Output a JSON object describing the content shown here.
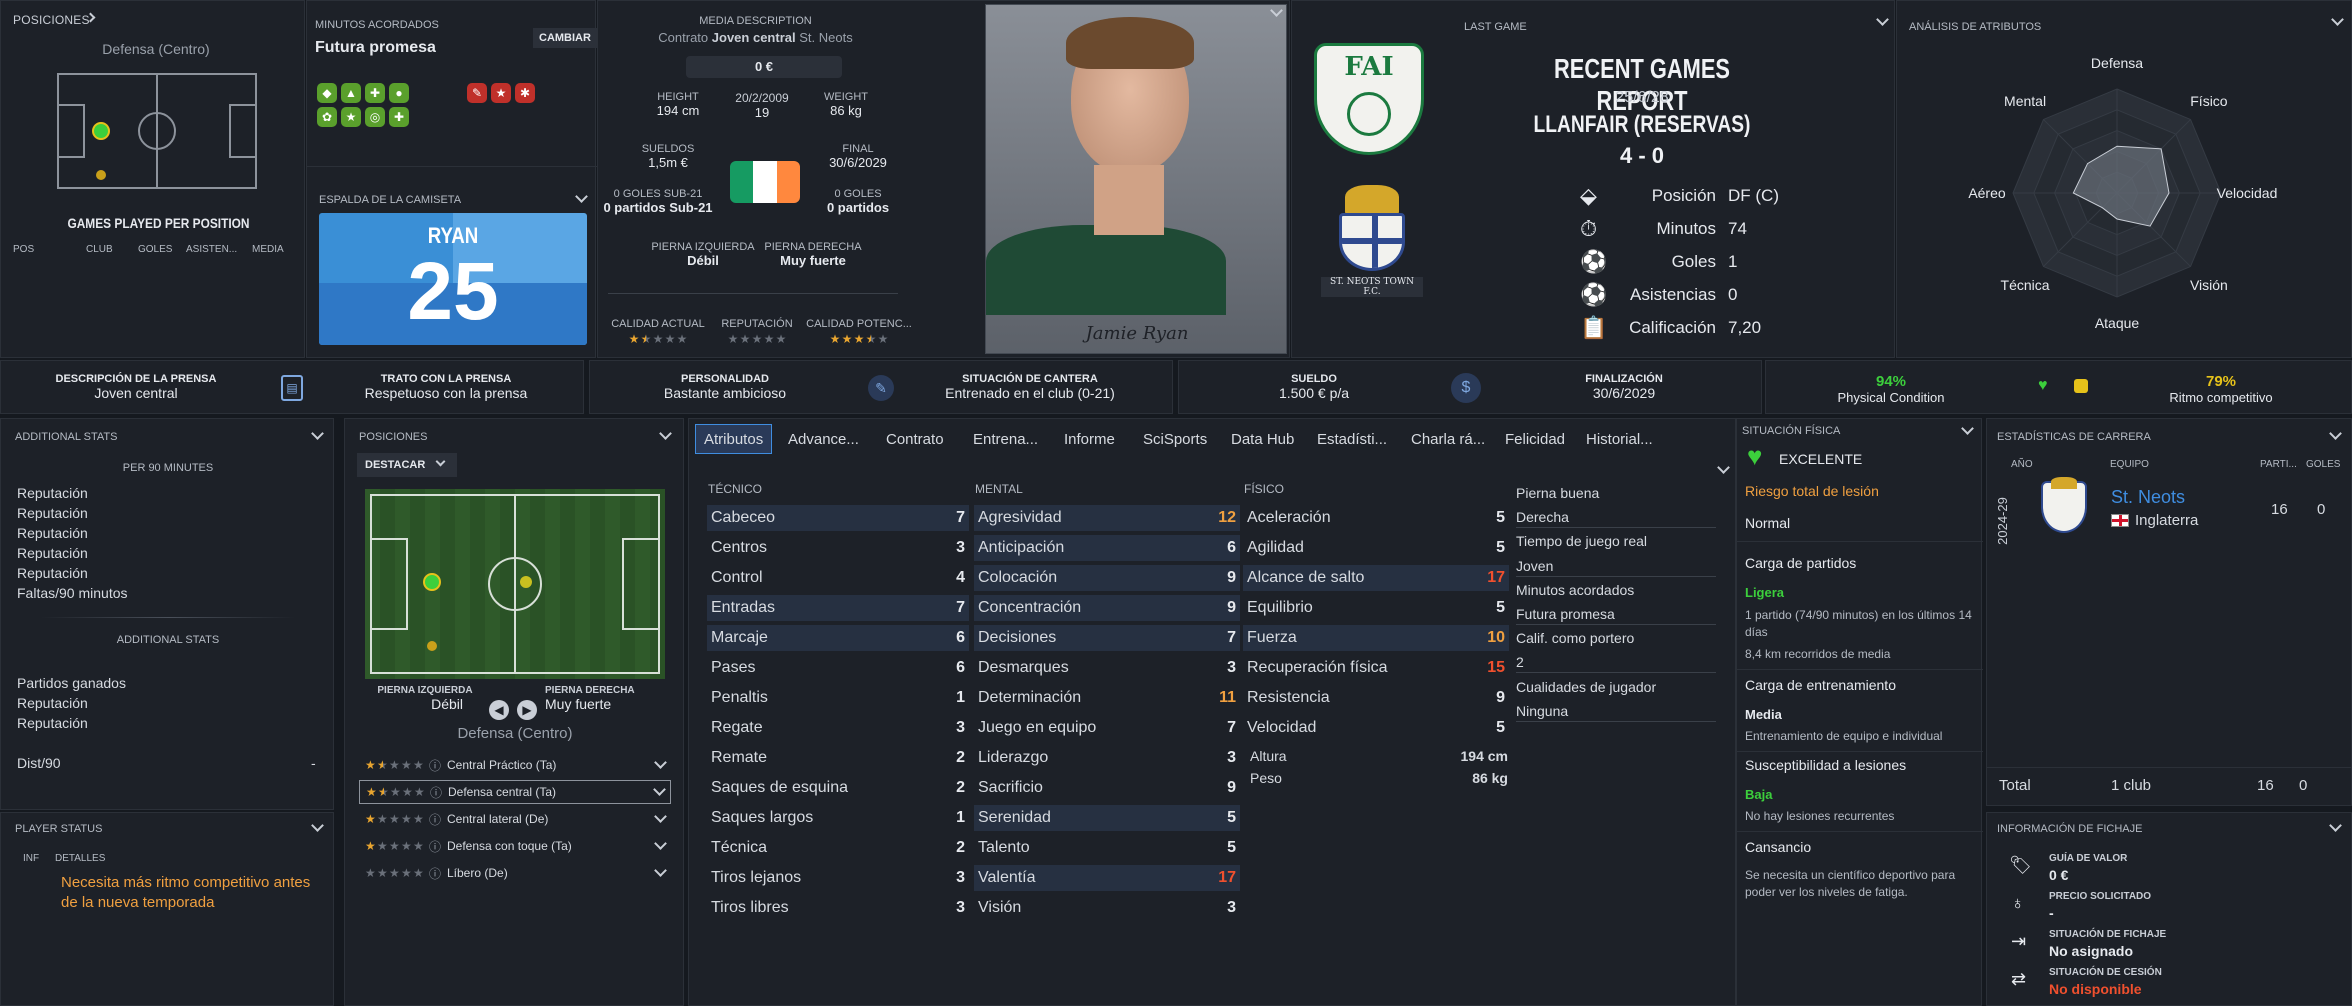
{
  "colors": {
    "accent_blue": "#3f8de0",
    "orange": "#f0a040",
    "red_value": "#f0502e",
    "green": "#3ccf3c",
    "yellow": "#e6c21a",
    "bg": "#15191f",
    "panel": "#1d2128"
  },
  "left_top": {
    "positions_label": "POSICIONES",
    "position": "Defensa (Centro)",
    "games_title": "GAMES PLAYED PER POSITION",
    "cols": [
      "POS",
      "CLUB",
      "GOLES",
      "ASISTEN...",
      "MEDIA"
    ]
  },
  "minutes": {
    "label": "MINUTOS ACORDADOS",
    "value": "Futura promesa",
    "change_button": "CAMBIAR"
  },
  "shirt": {
    "label": "ESPALDA DE LA CAMISETA",
    "name": "RYAN",
    "number": "25"
  },
  "media": {
    "desc_label": "MEDIA DESCRIPTION",
    "desc_value": "Joven central",
    "contract_label": "Contrato",
    "contract_club": "St. Neots",
    "value": "0 €"
  },
  "bio": {
    "height_label": "HEIGHT",
    "height": "194 cm",
    "dob": "20/2/2009",
    "age": "19",
    "weight_label": "WEIGHT",
    "weight": "86 kg",
    "wage_label": "SUELDOS",
    "wage": "1,5m €",
    "end_label": "FINAL",
    "end": "30/6/2029",
    "u21_goals": "0 GOLES SUB-21",
    "u21_games": "0 partidos Sub-21",
    "goals": "0 GOLES",
    "games": "0 partidos",
    "left_foot_label": "PIERNA IZQUIERDA",
    "left_foot": "Débil",
    "right_foot_label": "PIERNA DERECHA",
    "right_foot": "Muy fuerte",
    "ca_label": "CALIDAD ACTUAL",
    "rep_label": "REPUTACIÓN",
    "pa_label": "CALIDAD POTENC...",
    "ca_stars": 1.5,
    "rep_stars": 0,
    "pa_stars": 3.5
  },
  "photo": {
    "signature": "Jamie Ryan"
  },
  "last_game": {
    "label": "LAST GAME",
    "title": "RECENT GAMES REPORT",
    "date": "25/6/28",
    "opponent": "LLANFAIR (RESERVAS)",
    "score": "4 - 0",
    "position_label": "Posición",
    "position": "DF (C)",
    "minutes_label": "Minutos",
    "minutes": "74",
    "goals_label": "Goles",
    "goals": "1",
    "assists_label": "Asistencias",
    "assists": "0",
    "rating_label": "Calificación",
    "rating": "7,20",
    "fai_logo": "FAI",
    "club_crest_text": "ST. NEOTS TOWN F.C."
  },
  "radar": {
    "label": "ANÁLISIS DE ATRIBUTOS",
    "axes": [
      "Defensa",
      "Físico",
      "Velocidad",
      "Visión",
      "Ataque",
      "Técnica",
      "Aéreo",
      "Mental"
    ],
    "values": [
      0.45,
      0.6,
      0.5,
      0.45,
      0.25,
      0.2,
      0.42,
      0.4
    ]
  },
  "strip": {
    "press_desc_label": "DESCRIPCIÓN DE LA PRENSA",
    "press_desc": "Joven central",
    "press_treat_label": "TRATO CON LA PRENSA",
    "press_treat": "Respetuoso con la prensa",
    "personality_label": "PERSONALIDAD",
    "personality": "Bastante ambicioso",
    "youth_label": "SITUACIÓN DE CANTERA",
    "youth": "Entrenado en el club (0-21)",
    "wage_label": "SUELDO",
    "wage": "1.500 € p/a",
    "expiry_label": "FINALIZACIÓN",
    "expiry": "30/6/2029",
    "physical_pct": "94%",
    "physical_label": "Physical Condition",
    "match_pct": "79%",
    "match_label": "Ritmo competitivo"
  },
  "add_stats": {
    "title": "ADDITIONAL STATS",
    "per90": "PER 90 MINUTES",
    "list1": [
      "Reputación",
      "Reputación",
      "Reputación",
      "Reputación",
      "Reputación",
      "Faltas/90 minutos"
    ],
    "sub": "ADDITIONAL STATS",
    "list2": [
      "Partidos ganados",
      "Reputación",
      "Reputación"
    ],
    "dist_label": "Dist/90",
    "dist_val": "-"
  },
  "player_status": {
    "title": "PLAYER STATUS",
    "col1": "INF",
    "col2": "DETALLES",
    "message": "Necesita más ritmo competitivo antes de la nueva temporada"
  },
  "positions": {
    "title": "POSICIONES",
    "dropdown": "DESTACAR",
    "left_label": "PIERNA IZQUIERDA",
    "left": "Débil",
    "right_label": "PIERNA DERECHA",
    "right": "Muy fuerte",
    "position": "Defensa (Centro)",
    "roles": [
      {
        "name": "Central Práctico (Ta)",
        "stars": 1.5
      },
      {
        "name": "Defensa central (Ta)",
        "stars": 1.5
      },
      {
        "name": "Central lateral (De)",
        "stars": 1
      },
      {
        "name": "Defensa con toque (Ta)",
        "stars": 1
      },
      {
        "name": "Líbero (De)",
        "stars": 0
      }
    ]
  },
  "tabs": [
    "Atributos",
    "Advance...",
    "Contrato",
    "Entrena...",
    "Informe",
    "SciSports",
    "Data Hub",
    "Estadísti...",
    "Charla rá...",
    "Felicidad",
    "Historial..."
  ],
  "attributes": {
    "tecnico_label": "TÉCNICO",
    "mental_label": "MENTAL",
    "fisico_label": "FÍSICO",
    "tecnico": [
      {
        "n": "Cabeceo",
        "v": "7",
        "hl": true
      },
      {
        "n": "Centros",
        "v": "3"
      },
      {
        "n": "Control",
        "v": "4"
      },
      {
        "n": "Entradas",
        "v": "7",
        "hl": true
      },
      {
        "n": "Marcaje",
        "v": "6",
        "hl": true
      },
      {
        "n": "Pases",
        "v": "6"
      },
      {
        "n": "Penaltis",
        "v": "1"
      },
      {
        "n": "Regate",
        "v": "3"
      },
      {
        "n": "Remate",
        "v": "2"
      },
      {
        "n": "Saques de esquina",
        "v": "2"
      },
      {
        "n": "Saques largos",
        "v": "1"
      },
      {
        "n": "Técnica",
        "v": "2"
      },
      {
        "n": "Tiros lejanos",
        "v": "3"
      },
      {
        "n": "Tiros libres",
        "v": "3"
      }
    ],
    "mental": [
      {
        "n": "Agresividad",
        "v": "12",
        "hl": true
      },
      {
        "n": "Anticipación",
        "v": "6",
        "hl": true
      },
      {
        "n": "Colocación",
        "v": "9",
        "hl": true
      },
      {
        "n": "Concentración",
        "v": "9",
        "hl": true
      },
      {
        "n": "Decisiones",
        "v": "7",
        "hl": true
      },
      {
        "n": "Desmarques",
        "v": "3"
      },
      {
        "n": "Determinación",
        "v": "11"
      },
      {
        "n": "Juego en equipo",
        "v": "7"
      },
      {
        "n": "Liderazgo",
        "v": "3"
      },
      {
        "n": "Sacrificio",
        "v": "9"
      },
      {
        "n": "Serenidad",
        "v": "5",
        "hl": true
      },
      {
        "n": "Talento",
        "v": "5"
      },
      {
        "n": "Valentía",
        "v": "17",
        "hl": true
      },
      {
        "n": "Visión",
        "v": "3"
      }
    ],
    "fisico": [
      {
        "n": "Aceleración",
        "v": "5"
      },
      {
        "n": "Agilidad",
        "v": "5"
      },
      {
        "n": "Alcance de salto",
        "v": "17",
        "hl": true
      },
      {
        "n": "Equilibrio",
        "v": "5"
      },
      {
        "n": "Fuerza",
        "v": "10",
        "hl": true
      },
      {
        "n": "Recuperación física",
        "v": "15"
      },
      {
        "n": "Resistencia",
        "v": "9"
      },
      {
        "n": "Velocidad",
        "v": "5"
      }
    ],
    "height_label": "Altura",
    "height": "194 cm",
    "weight_label": "Peso",
    "weight": "86 kg"
  },
  "side_info": [
    "Pierna buena",
    "Derecha",
    "Tiempo de juego real",
    "Joven",
    "Minutos acordados",
    "Futura promesa",
    "Calif. como portero",
    "2",
    "Cualidades de jugador",
    "Ninguna"
  ],
  "physical": {
    "title": "SITUACIÓN FÍSICA",
    "status": "EXCELENTE",
    "risk": "Riesgo total de lesión",
    "risk_val": "Normal",
    "load_title": "Carga de partidos",
    "load_val": "Ligera",
    "load_desc": "1 partido (74/90 minutos) en los últimos 14 días",
    "load_km": "8,4 km recorridos de media",
    "train_title": "Carga de entrenamiento",
    "train_val": "Media",
    "train_desc": "Entrenamiento de equipo e individual",
    "susc_title": "Susceptibilidad a lesiones",
    "susc_val": "Baja",
    "susc_desc": "No hay lesiones recurrentes",
    "fatigue_title": "Cansancio",
    "fatigue_desc": "Se necesita un científico deportivo para poder ver los niveles de fatiga."
  },
  "career": {
    "title": "ESTADÍSTICAS DE CARRERA",
    "col_year": "AÑO",
    "col_team": "EQUIPO",
    "col_games": "PARTI...",
    "col_goals": "GOLES",
    "year": "2024-29",
    "team": "St. Neots",
    "country": "Inglaterra",
    "games": "16",
    "goals": "0",
    "total_label": "Total",
    "total_clubs": "1 club",
    "total_games": "16",
    "total_goals": "0"
  },
  "transfer": {
    "title": "INFORMACIÓN DE FICHAJE",
    "value_label": "GUÍA DE VALOR",
    "value": "0 €",
    "asking_label": "PRECIO SOLICITADO",
    "asking": "-",
    "status_label": "SITUACIÓN DE FICHAJE",
    "status": "No asignado",
    "loan_label": "SITUACIÓN DE CESIÓN",
    "loan": "No disponible"
  }
}
